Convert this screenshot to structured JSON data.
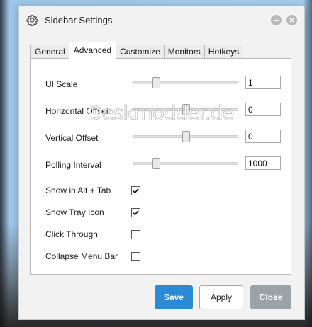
{
  "window": {
    "title": "Sidebar Settings",
    "icons": {
      "app": "gear-icon",
      "minimize": "minimize-icon",
      "close": "close-icon"
    }
  },
  "tabs": [
    {
      "label": "General",
      "active": false
    },
    {
      "label": "Advanced",
      "active": true
    },
    {
      "label": "Customize",
      "active": false
    },
    {
      "label": "Monitors",
      "active": false
    },
    {
      "label": "Hotkeys",
      "active": false
    }
  ],
  "settings": {
    "ui_scale": {
      "label": "UI Scale",
      "value": "1",
      "slider_level": 0.2
    },
    "horizontal_offset": {
      "label": "Horizontal Offset",
      "value": "0",
      "slider_level": 0.5
    },
    "vertical_offset": {
      "label": "Vertical Offset",
      "value": "0",
      "slider_level": 0.5
    },
    "polling_interval": {
      "label": "Polling Interval",
      "value": "1000",
      "slider_level": 0.2
    },
    "show_in_alt_tab": {
      "label": "Show in Alt + Tab",
      "checked": true
    },
    "show_tray_icon": {
      "label": "Show Tray Icon",
      "checked": true
    },
    "click_through": {
      "label": "Click Through",
      "checked": false
    },
    "collapse_menu_bar": {
      "label": "Collapse Menu Bar",
      "checked": false
    }
  },
  "watermark": "Deskmodder.de",
  "buttons": {
    "save": "Save",
    "apply": "Apply",
    "close": "Close"
  },
  "colors": {
    "accent": "#2b8ad3",
    "close_button": "#9aa4a8"
  }
}
